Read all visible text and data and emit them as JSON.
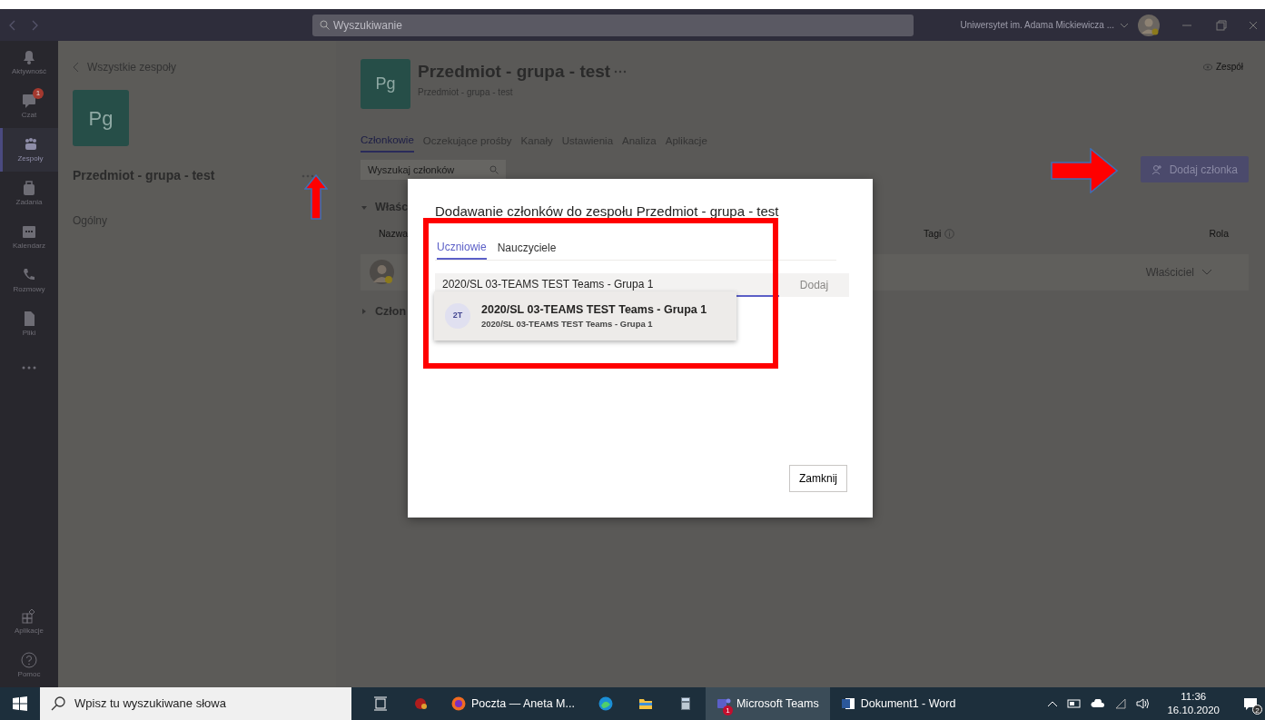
{
  "title_bar": {
    "search_placeholder": "Wyszukiwanie",
    "organization": "Uniwersytet im. Adama Mickiewicza ..."
  },
  "app_bar": {
    "items": [
      {
        "kind": "bell",
        "label": "Aktywność",
        "selected": false
      },
      {
        "kind": "chat",
        "label": "Czat",
        "selected": false,
        "badge": "1"
      },
      {
        "kind": "teams",
        "label": "Zespoły",
        "selected": true
      },
      {
        "kind": "bag",
        "label": "Zadania",
        "selected": false
      },
      {
        "kind": "calendar",
        "label": "Kalendarz",
        "selected": false
      },
      {
        "kind": "phone",
        "label": "Rozmowy",
        "selected": false
      },
      {
        "kind": "file",
        "label": "Pliki",
        "selected": false
      },
      {
        "kind": "more",
        "selected": false
      }
    ],
    "bottom_items": [
      {
        "kind": "apps",
        "label": "Aplikacje"
      },
      {
        "kind": "help",
        "label": "Pomoc"
      }
    ]
  },
  "team_panel": {
    "back_link": "Wszystkie zespoły",
    "avatar": "Pg",
    "team_name": "Przedmiot - grupa - test",
    "channels": [
      {
        "label": "Ogólny"
      }
    ]
  },
  "header": {
    "avatar": "Pg",
    "title": "Przedmiot - grupa - test",
    "subtitle": "Przedmiot - grupa - test",
    "team_button": "Zespół"
  },
  "tabs": [
    {
      "label": "Członkowie",
      "selected": true
    },
    {
      "label": "Oczekujące prośby",
      "selected": false
    },
    {
      "label": "Kanały",
      "selected": false
    },
    {
      "label": "Ustawienia",
      "selected": false
    },
    {
      "label": "Analiza",
      "selected": false
    },
    {
      "label": "Aplikacje",
      "selected": false
    }
  ],
  "member_search": {
    "placeholder": "Wyszukaj członków"
  },
  "add_member_button": "Dodaj członka",
  "owners_section": {
    "title": "Właśc",
    "expanded": true,
    "columns": [
      "Nazwa",
      "Tagi",
      "Rola"
    ],
    "rows": [
      {
        "role": "Właściciel"
      }
    ]
  },
  "members_section": {
    "title": "Człon",
    "expanded": false
  },
  "dialog": {
    "title": "Dodawanie członków do zespołu Przedmiot - grupa - test",
    "tabs": [
      {
        "label": "Uczniowie",
        "selected": true
      },
      {
        "label": "Nauczyciele",
        "selected": false
      }
    ],
    "input_value": "2020/SL 03-TEAMS TEST Teams - Grupa 1",
    "add_button": {
      "label": "Dodaj",
      "disabled": true
    },
    "suggestions": [
      {
        "initials": "2T",
        "name": "2020/SL 03-TEAMS TEST Teams - Grupa 1",
        "detail": "2020/SL 03-TEAMS TEST Teams - Grupa 1"
      }
    ],
    "close_button": "Zamknij"
  },
  "annotations": [
    {
      "kind": "up-arrow"
    },
    {
      "kind": "right-arrow"
    },
    {
      "kind": "highlight-box"
    }
  ],
  "taskbar": {
    "search_placeholder": "Wpisz tu wyszukiwane słowa",
    "apps": [
      {
        "kind": "taskview",
        "selected": false
      },
      {
        "kind": "game",
        "selected": false
      },
      {
        "kind": "firefox",
        "label": "Poczta — Aneta M...",
        "selected": false
      },
      {
        "kind": "edge",
        "selected": false
      },
      {
        "kind": "explorer",
        "selected": false
      },
      {
        "kind": "calculator",
        "selected": false
      },
      {
        "kind": "teams",
        "label": "Microsoft Teams",
        "selected": true,
        "badge": "1"
      },
      {
        "kind": "word",
        "label": "Dokument1 - Word",
        "selected": false
      }
    ],
    "time": "11:36",
    "date": "16.10.2020",
    "notification_badge": "2"
  }
}
